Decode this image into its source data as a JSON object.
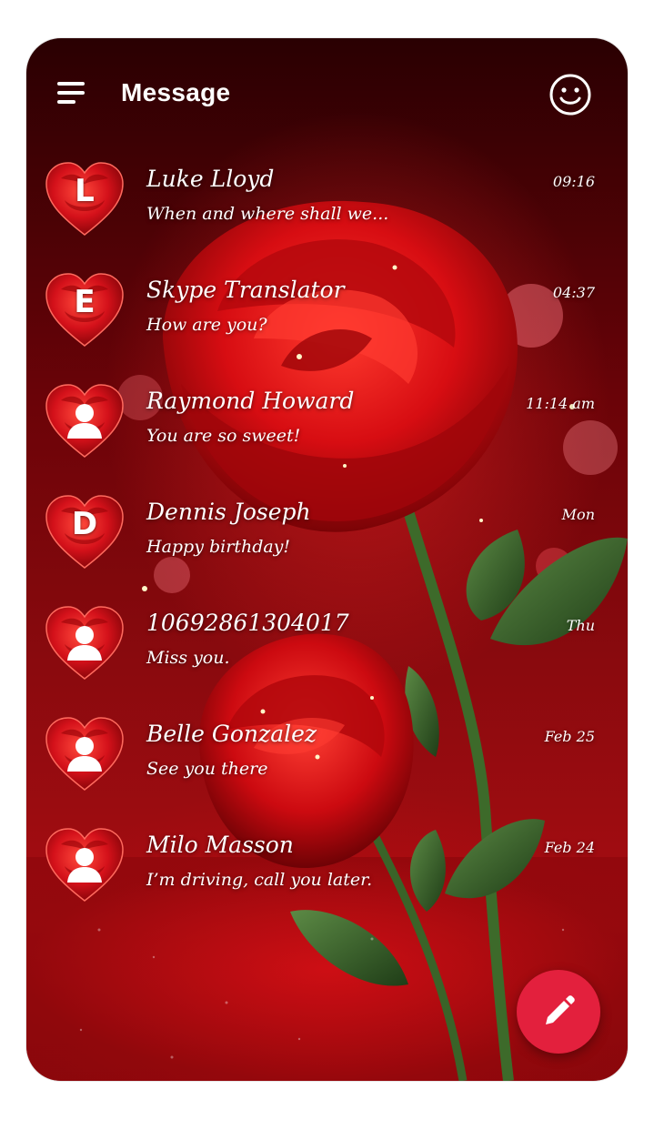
{
  "header": {
    "title": "Message",
    "menu_icon": "hamburger-menu-icon",
    "emoji_icon": "smiley-face-icon"
  },
  "conversations": [
    {
      "name": "Luke Lloyd",
      "preview": "When and where shall we...",
      "time": "09:16",
      "avatar_letter": "L"
    },
    {
      "name": "Skype Translator",
      "preview": "How are you?",
      "time": "04:37",
      "avatar_letter": "E"
    },
    {
      "name": "Raymond Howard",
      "preview": "You are so sweet!",
      "time": "11:14 am",
      "avatar_letter": ""
    },
    {
      "name": "Dennis Joseph",
      "preview": "Happy birthday!",
      "time": "Mon",
      "avatar_letter": "D"
    },
    {
      "name": "10692861304017",
      "preview": "Miss you.",
      "time": "Thu",
      "avatar_letter": ""
    },
    {
      "name": "Belle Gonzalez",
      "preview": "See you there",
      "time": "Feb 25",
      "avatar_letter": ""
    },
    {
      "name": "Milo Masson",
      "preview": "I’m driving, call you later.",
      "time": "Feb 24",
      "avatar_letter": ""
    }
  ],
  "fab": {
    "icon": "pencil-compose-icon"
  },
  "colors": {
    "accent": "#e3203d",
    "background_dark": "#2a0002",
    "background_red": "#a80d12",
    "heart_red": "#d4111a",
    "text": "#ffffff"
  }
}
